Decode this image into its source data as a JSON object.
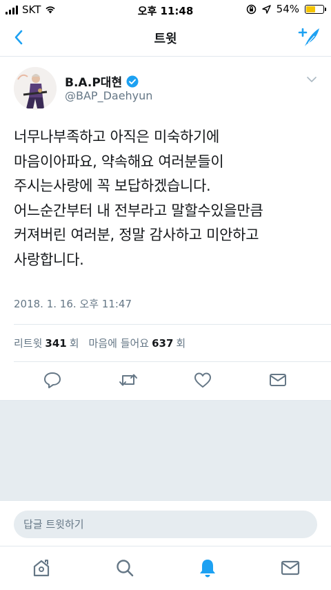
{
  "status_bar": {
    "carrier": "SKT",
    "time": "오후 11:48",
    "battery_percent": "54%",
    "battery_level": 0.54
  },
  "nav": {
    "title": "트윗",
    "back_icon": "chevron-left-icon",
    "compose_icon": "compose-tweet-icon"
  },
  "tweet": {
    "display_name": "B.A.P대현",
    "handle": "@BAP_Daehyun",
    "verified": true,
    "text": "너무나부족하고 아직은 미숙하기에\n마음이아파요, 약속해요 여러분들이\n주시는사랑에 꼭 보답하겠습니다.\n어느순간부터 내 전부라고 말할수있을만큼\n커져버린 여러분, 정말 감사하고 미안하고\n사랑합니다.",
    "timestamp": "2018. 1. 16. 오후 11:47",
    "retweet_label": "리트윗",
    "retweet_count": "341",
    "retweet_unit": "회",
    "like_label": "마음에 들어요",
    "like_count": "637",
    "like_unit": "회"
  },
  "actions": [
    "reply-icon",
    "retweet-icon",
    "like-icon",
    "direct-message-icon"
  ],
  "reply": {
    "placeholder": "답글 트윗하기"
  },
  "tab_bar": {
    "tabs": [
      "home-icon",
      "search-icon",
      "notifications-icon",
      "messages-icon"
    ],
    "active": "notifications-icon"
  },
  "colors": {
    "accent": "#1da1f2",
    "text": "#14171a",
    "secondary": "#657786",
    "border": "#e1e8ed",
    "background_gray": "#e6ecf0"
  }
}
